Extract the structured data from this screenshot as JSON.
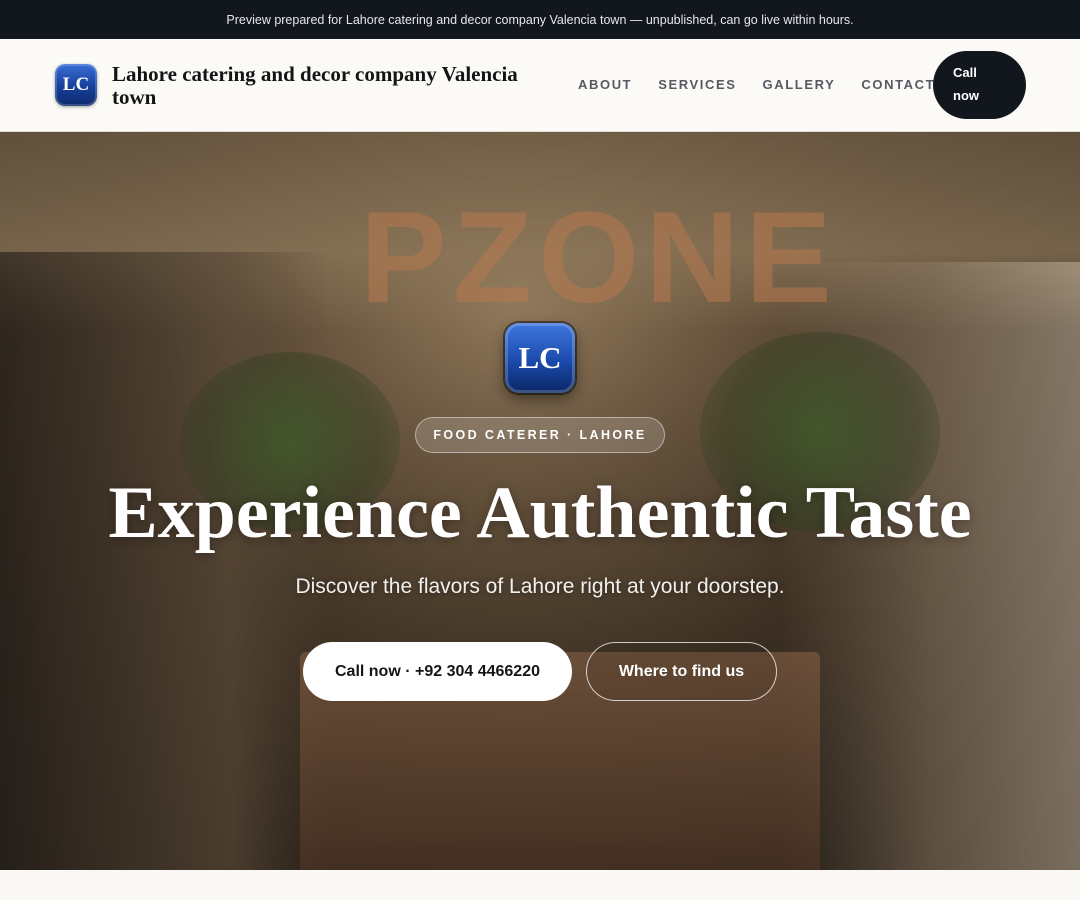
{
  "preview_bar": {
    "text": "Preview prepared for Lahore catering and decor company Valencia town — unpublished, can go live within hours."
  },
  "header": {
    "logo_text": "LC",
    "brand_name": "Lahore catering and decor company Valencia town",
    "nav": [
      "ABOUT",
      "SERVICES",
      "GALLERY",
      "CONTACT"
    ],
    "call_button": "Call now"
  },
  "hero": {
    "logo_text": "LC",
    "badge": "FOOD CATERER · LAHORE",
    "title": "Experience Authentic Taste",
    "subtitle": "Discover the flavors of Lahore right at your doorstep.",
    "primary_button": "Call now · +92 304 4466220",
    "secondary_button": "Where to find us",
    "background_sign_text": "PZONE"
  },
  "colors": {
    "dark": "#12161d",
    "logo_blue": "#1a4aab",
    "light_bg": "#fbfaf7"
  }
}
